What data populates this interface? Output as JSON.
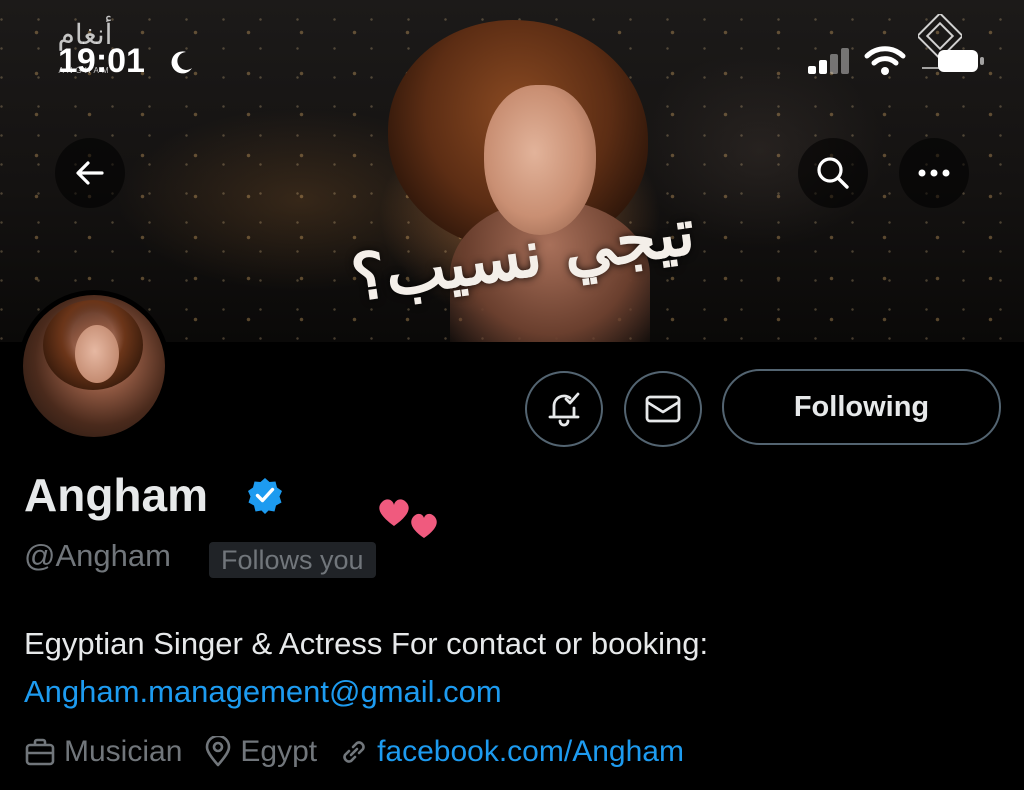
{
  "status_bar": {
    "time": "19:01"
  },
  "banner": {
    "calligraphy": "تيجي نسيب؟",
    "logo_left_mark": "أنغام",
    "logo_left_word": "ANGHAM"
  },
  "header": {
    "back_icon": "arrow-left-icon",
    "search_icon": "search-icon",
    "more_icon": "more-horizontal-icon"
  },
  "profile": {
    "name": "Angham",
    "handle": "@Angham",
    "follows_badge": "Follows you",
    "bio_text": "Egyptian Singer & Actress For contact or booking:",
    "bio_email": "Angham.management@gmail.com",
    "category": "Musician",
    "location": "Egypt",
    "website": "facebook.com/Angham"
  },
  "actions": {
    "following_label": "Following",
    "notify_icon": "bell-check-icon",
    "message_icon": "envelope-icon"
  },
  "colors": {
    "accent": "#1d9bf0",
    "muted": "#71767b",
    "border": "#536471",
    "background": "#000000",
    "text": "#e7e9ea",
    "heart": "#f05a7e"
  }
}
